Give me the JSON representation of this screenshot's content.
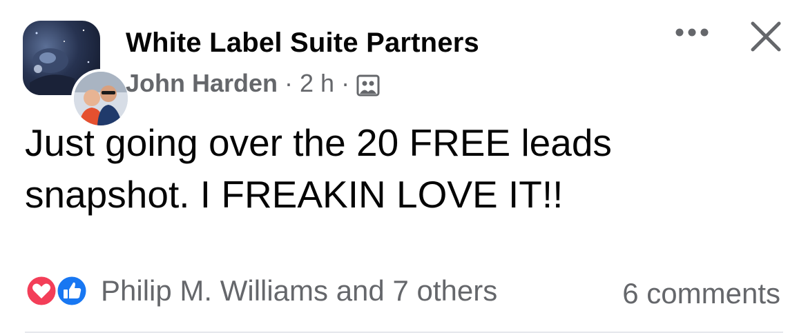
{
  "post": {
    "group_name": "White Label Suite Partners",
    "author": "John Harden",
    "separator": "·",
    "time": "2 h",
    "audience_icon": "photo-audience-icon",
    "text": "Just going over the 20 FREE leads snapshot. I FREAKIN LOVE IT!!"
  },
  "reactions": {
    "icons": [
      "love-reaction-icon",
      "like-reaction-icon"
    ],
    "summary": "Philip M. Williams and 7 others"
  },
  "comments": {
    "label": "6 comments"
  },
  "colors": {
    "text_primary": "#050505",
    "text_secondary": "#65676b",
    "love_red": "#f33e58",
    "like_blue": "#1877f2",
    "divider": "#e4e6eb"
  }
}
